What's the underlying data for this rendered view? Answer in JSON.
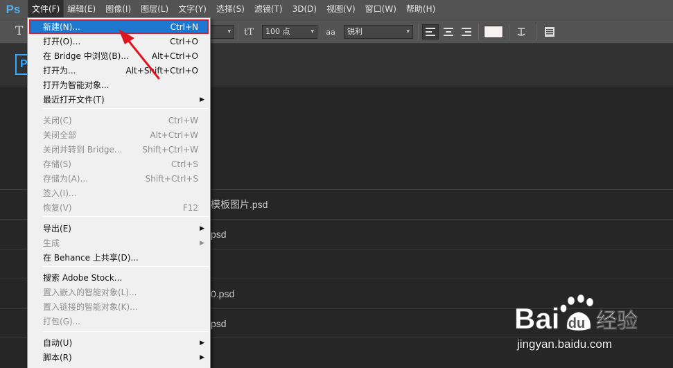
{
  "app": {
    "logo_text": "Ps"
  },
  "menubar": {
    "items": [
      "文件(F)",
      "编辑(E)",
      "图像(I)",
      "图层(L)",
      "文字(Y)",
      "选择(S)",
      "滤镜(T)",
      "3D(D)",
      "视图(V)",
      "窗口(W)",
      "帮助(H)"
    ],
    "active_index": 0
  },
  "options_bar": {
    "tool_glyph": "T",
    "font_size_icon": "tT",
    "font_size_value": "100 点",
    "aa_icon": "aa",
    "antialias_value": "锐利",
    "text_color": "#f7f1f1"
  },
  "start_screen": {
    "badge_text": "Ps",
    "recent_files": [
      "模板图片.psd",
      "psd",
      "",
      "0.psd",
      "psd"
    ]
  },
  "file_menu": {
    "items": [
      {
        "label": "新建(N)...",
        "shortcut": "Ctrl+N",
        "enabled": true,
        "selected": true
      },
      {
        "label": "打开(O)...",
        "shortcut": "Ctrl+O",
        "enabled": true
      },
      {
        "label": "在 Bridge 中浏览(B)...",
        "shortcut": "Alt+Ctrl+O",
        "enabled": true
      },
      {
        "label": "打开为...",
        "shortcut": "Alt+Shift+Ctrl+O",
        "enabled": true
      },
      {
        "label": "打开为智能对象...",
        "shortcut": "",
        "enabled": true
      },
      {
        "label": "最近打开文件(T)",
        "shortcut": "",
        "enabled": true,
        "submenu": true
      },
      {
        "label": "关闭(C)",
        "shortcut": "Ctrl+W",
        "enabled": false
      },
      {
        "label": "关闭全部",
        "shortcut": "Alt+Ctrl+W",
        "enabled": false
      },
      {
        "label": "关闭并转到 Bridge...",
        "shortcut": "Shift+Ctrl+W",
        "enabled": false
      },
      {
        "label": "存储(S)",
        "shortcut": "Ctrl+S",
        "enabled": false
      },
      {
        "label": "存储为(A)...",
        "shortcut": "Shift+Ctrl+S",
        "enabled": false
      },
      {
        "label": "签入(I)...",
        "shortcut": "",
        "enabled": false
      },
      {
        "label": "恢复(V)",
        "shortcut": "F12",
        "enabled": false
      },
      {
        "label": "导出(E)",
        "shortcut": "",
        "enabled": true,
        "submenu": true
      },
      {
        "label": "生成",
        "shortcut": "",
        "enabled": false,
        "submenu": true
      },
      {
        "label": "在 Behance 上共享(D)...",
        "shortcut": "",
        "enabled": true
      },
      {
        "label": "搜索 Adobe Stock...",
        "shortcut": "",
        "enabled": true
      },
      {
        "label": "置入嵌入的智能对象(L)...",
        "shortcut": "",
        "enabled": false
      },
      {
        "label": "置入链接的智能对象(K)...",
        "shortcut": "",
        "enabled": false
      },
      {
        "label": "打包(G)...",
        "shortcut": "",
        "enabled": false
      },
      {
        "label": "自动(U)",
        "shortcut": "",
        "enabled": true,
        "submenu": true
      },
      {
        "label": "脚本(R)",
        "shortcut": "",
        "enabled": true,
        "submenu": true
      }
    ],
    "submenu_glyph": "▶"
  },
  "watermark": {
    "brand": "Bai",
    "brand_cn": "经验",
    "url": "jingyan.baidu.com"
  },
  "colors": {
    "menubar": "#535353",
    "selection": "#1e78d0",
    "highlight_box": "#d81e2b",
    "ps_blue": "#31a8ff"
  }
}
